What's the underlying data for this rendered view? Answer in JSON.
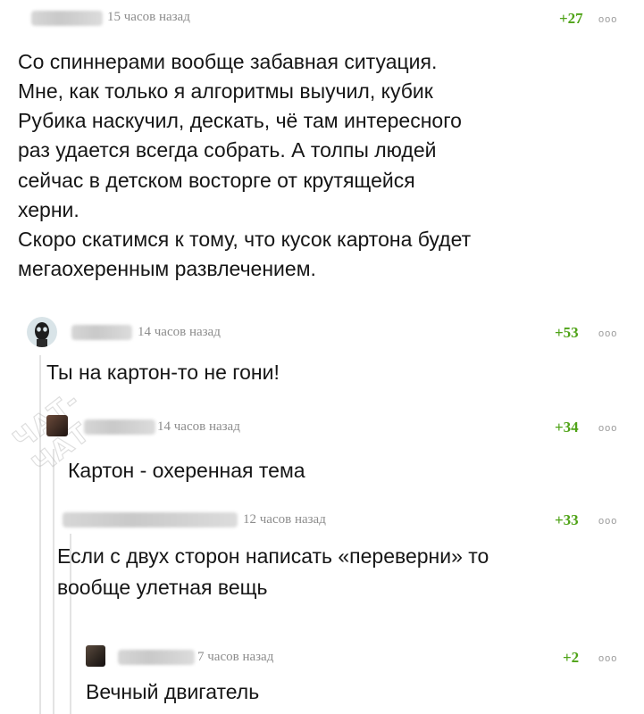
{
  "comments": [
    {
      "time": "15 часов назад",
      "rating": "+27",
      "more": "ooo",
      "lines": [
        "Со спиннерами вообще забавная ситуация.",
        "Мне, как только я алгоритмы выучил, кубик",
        "Рубика наскучил, дескать, чё там интересного",
        "раз удается всегда собрать. А толпы людей",
        "сейчас в детском восторге от крутящейся",
        "херни.",
        "Скоро скатимся к тому, что кусок картона будет",
        "мегаохеренным развлечением."
      ]
    },
    {
      "time": "14 часов назад",
      "rating": "+53",
      "more": "ooo",
      "lines": [
        "Ты на картон-то не гони!"
      ]
    },
    {
      "time": "14 часов назад",
      "rating": "+34",
      "more": "ooo",
      "lines": [
        "Картон - охеренная тема"
      ]
    },
    {
      "time": "12 часов назад",
      "rating": "+33",
      "more": "ooo",
      "lines": [
        "Если с двух сторон написать «переверни» то",
        "вообще улетная вещь"
      ]
    },
    {
      "time": "7 часов назад",
      "rating": "+2",
      "more": "ooo",
      "lines": [
        "Вечный двигатель"
      ]
    }
  ],
  "watermark": "ЧАТ-ЧАТ",
  "colors": {
    "rating": "#4fa317",
    "time": "#8c8c8c",
    "thread_line": "#e3e3e3"
  }
}
